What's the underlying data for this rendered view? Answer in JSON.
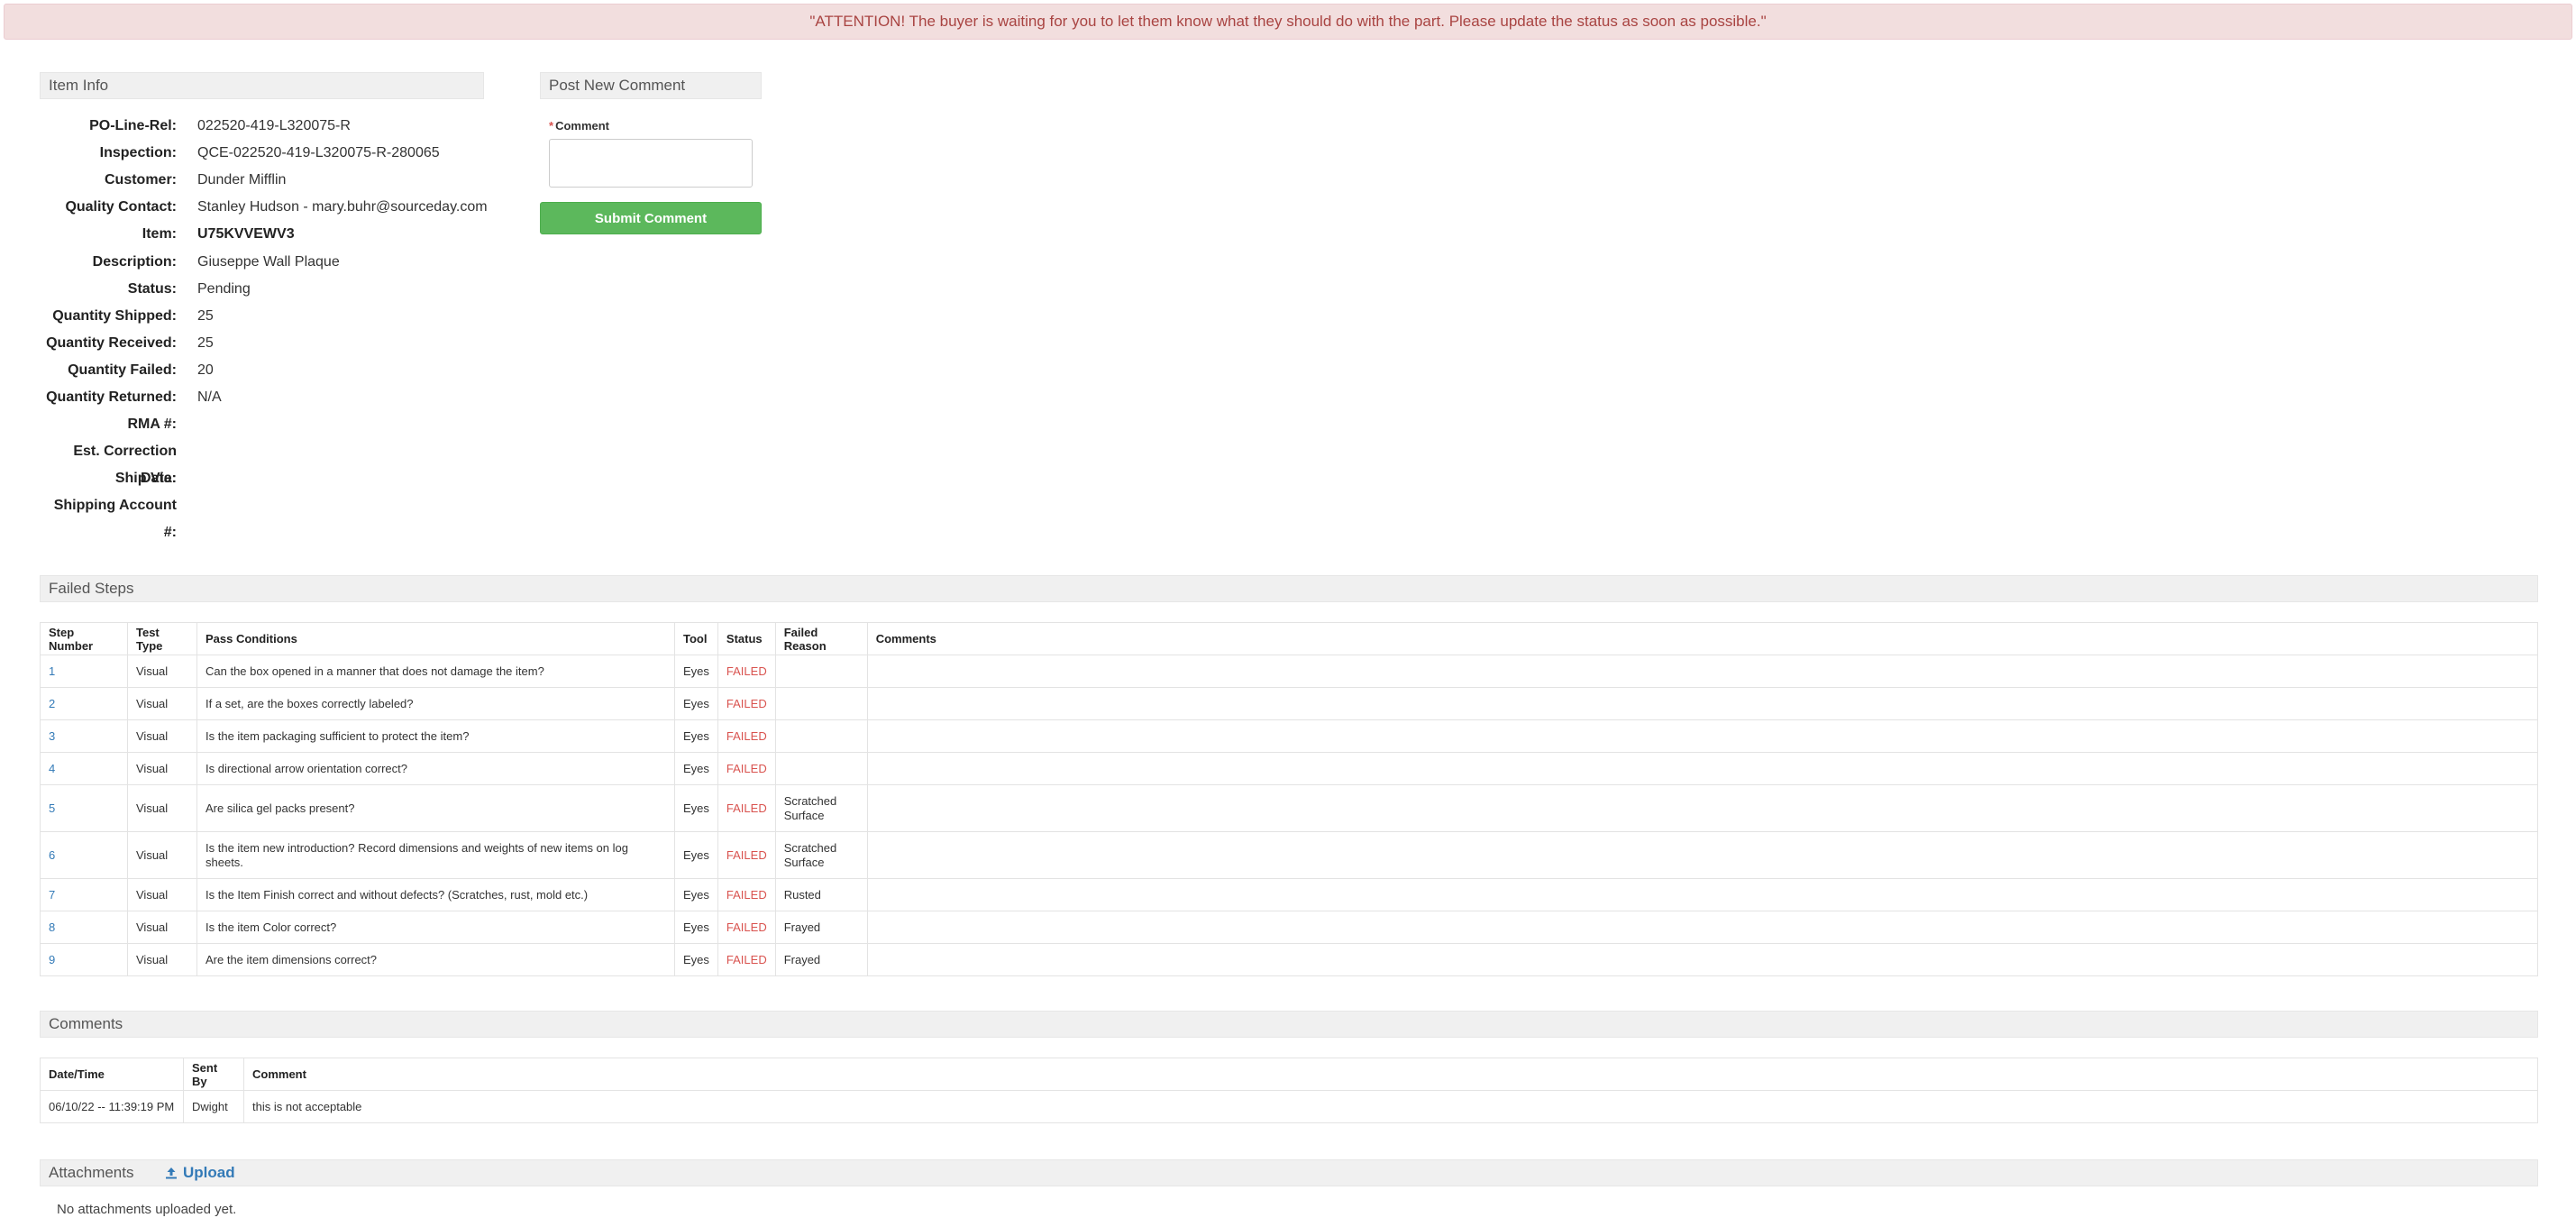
{
  "alert": "\"ATTENTION! The buyer is waiting for you to let them know what they should do with the part. Please update the status as soon as possible.\"",
  "item_info": {
    "header": "Item Info",
    "fields": [
      {
        "label": "PO-Line-Rel:",
        "value": "022520-419-L320075-R"
      },
      {
        "label": "Inspection:",
        "value": "QCE-022520-419-L320075-R-280065"
      },
      {
        "label": "Customer:",
        "value": "Dunder Mifflin"
      },
      {
        "label": "Quality Contact:",
        "value": "Stanley Hudson - mary.buhr@sourceday.com"
      },
      {
        "label": "Item:",
        "value": "U75KVVEWV3"
      },
      {
        "label": "Description:",
        "value": "Giuseppe Wall Plaque"
      },
      {
        "label": "Status:",
        "value": "Pending"
      },
      {
        "label": "Quantity Shipped:",
        "value": "25"
      },
      {
        "label": "Quantity Received:",
        "value": "25"
      },
      {
        "label": "Quantity Failed:",
        "value": "20"
      },
      {
        "label": "Quantity Returned:",
        "value": "N/A"
      },
      {
        "label": "RMA #:",
        "value": ""
      },
      {
        "label": "Est. Correction Date:",
        "value": ""
      },
      {
        "label": "Ship Via:",
        "value": ""
      },
      {
        "label": "Shipping Account #:",
        "value": ""
      }
    ]
  },
  "post_comment": {
    "header": "Post New Comment",
    "required_mark": "*",
    "label": "Comment",
    "value": "",
    "submit_label": "Submit Comment"
  },
  "failed_steps": {
    "header": "Failed Steps",
    "columns": [
      "Step Number",
      "Test Type",
      "Pass Conditions",
      "Tool",
      "Status",
      "Failed Reason",
      "Comments"
    ],
    "rows": [
      {
        "step": "1",
        "type": "Visual",
        "condition": "Can the box opened in a manner that does not damage the item?",
        "tool": "Eyes",
        "status": "FAILED",
        "reason": [],
        "comments": ""
      },
      {
        "step": "2",
        "type": "Visual",
        "condition": "If a set, are the boxes correctly labeled?",
        "tool": "Eyes",
        "status": "FAILED",
        "reason": [],
        "comments": ""
      },
      {
        "step": "3",
        "type": "Visual",
        "condition": "Is the item packaging sufficient to protect the item?",
        "tool": "Eyes",
        "status": "FAILED",
        "reason": [],
        "comments": ""
      },
      {
        "step": "4",
        "type": "Visual",
        "condition": "Is directional arrow orientation correct?",
        "tool": "Eyes",
        "status": "FAILED",
        "reason": [],
        "comments": ""
      },
      {
        "step": "5",
        "type": "Visual",
        "condition": "Are silica gel packs present?",
        "tool": "Eyes",
        "status": "FAILED",
        "reason": [
          "Scratched",
          "Surface"
        ],
        "comments": ""
      },
      {
        "step": "6",
        "type": "Visual",
        "condition": "Is the item new introduction? Record dimensions and weights of new items on log sheets.",
        "tool": "Eyes",
        "status": "FAILED",
        "reason": [
          "Scratched",
          "Surface"
        ],
        "comments": ""
      },
      {
        "step": "7",
        "type": "Visual",
        "condition": "Is the Item Finish correct and without defects? (Scratches, rust, mold etc.)",
        "tool": "Eyes",
        "status": "FAILED",
        "reason": [
          "Rusted"
        ],
        "comments": ""
      },
      {
        "step": "8",
        "type": "Visual",
        "condition": "Is the item Color correct?",
        "tool": "Eyes",
        "status": "FAILED",
        "reason": [
          "Frayed"
        ],
        "comments": ""
      },
      {
        "step": "9",
        "type": "Visual",
        "condition": "Are the item dimensions correct?",
        "tool": "Eyes",
        "status": "FAILED",
        "reason": [
          "Frayed"
        ],
        "comments": ""
      }
    ]
  },
  "comments": {
    "header": "Comments",
    "columns": [
      "Date/Time",
      "Sent By",
      "Comment"
    ],
    "rows": [
      {
        "datetime": "06/10/22 -- 11:39:19 PM",
        "sender": "Dwight",
        "text": "this is not acceptable"
      }
    ]
  },
  "attachments": {
    "header": "Attachments",
    "upload_label": "Upload",
    "upload_icon": "upload-icon",
    "empty_text": "No attachments uploaded yet."
  },
  "colors": {
    "alert_bg": "#f2dede",
    "alert_text": "#a94442",
    "submit_bg": "#5cb85c",
    "failed_text": "#d9534f",
    "link": "#337ab7"
  }
}
